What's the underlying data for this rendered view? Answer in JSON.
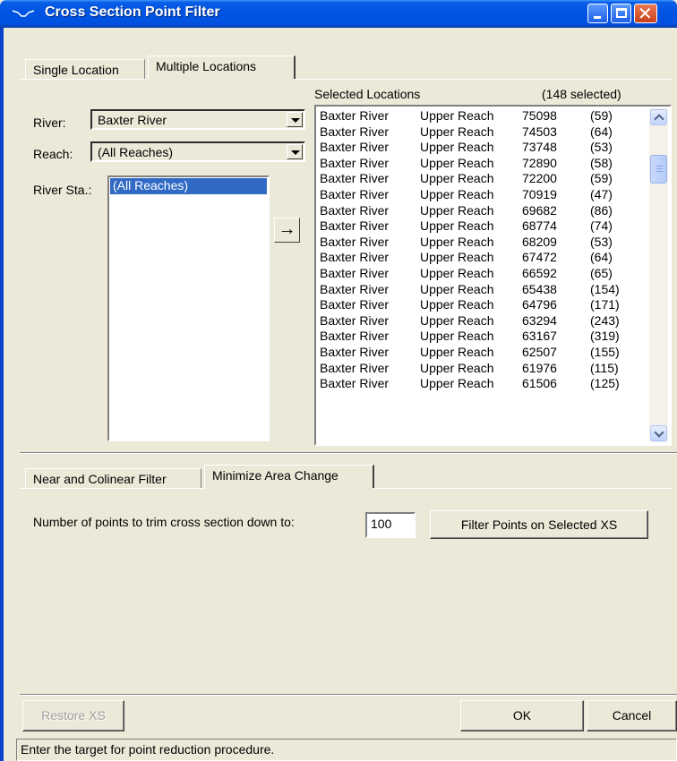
{
  "window": {
    "title": "Cross Section Point Filter"
  },
  "top_tabs": [
    "Single Location",
    "Multiple Locations"
  ],
  "river": {
    "label": "River:",
    "value": "Baxter River"
  },
  "reach": {
    "label": "Reach:",
    "value": "(All Reaches)"
  },
  "river_sta": {
    "label": "River Sta.:",
    "selected_item": "(All Reaches)"
  },
  "add_arrow": "→",
  "selected_locations": {
    "header": "Selected Locations",
    "count_text": "(148 selected)",
    "rows": [
      {
        "river": "Baxter River",
        "reach": "Upper Reach",
        "station": "75098",
        "points": "(59)"
      },
      {
        "river": "Baxter River",
        "reach": "Upper Reach",
        "station": "74503",
        "points": "(64)"
      },
      {
        "river": "Baxter River",
        "reach": "Upper Reach",
        "station": "73748",
        "points": "(53)"
      },
      {
        "river": "Baxter River",
        "reach": "Upper Reach",
        "station": "72890",
        "points": "(58)"
      },
      {
        "river": "Baxter River",
        "reach": "Upper Reach",
        "station": "72200",
        "points": "(59)"
      },
      {
        "river": "Baxter River",
        "reach": "Upper Reach",
        "station": "70919",
        "points": "(47)"
      },
      {
        "river": "Baxter River",
        "reach": "Upper Reach",
        "station": "69682",
        "points": "(86)"
      },
      {
        "river": "Baxter River",
        "reach": "Upper Reach",
        "station": "68774",
        "points": "(74)"
      },
      {
        "river": "Baxter River",
        "reach": "Upper Reach",
        "station": "68209",
        "points": "(53)"
      },
      {
        "river": "Baxter River",
        "reach": "Upper Reach",
        "station": "67472",
        "points": "(64)"
      },
      {
        "river": "Baxter River",
        "reach": "Upper Reach",
        "station": "66592",
        "points": "(65)"
      },
      {
        "river": "Baxter River",
        "reach": "Upper Reach",
        "station": "65438",
        "points": "(154)"
      },
      {
        "river": "Baxter River",
        "reach": "Upper Reach",
        "station": "64796",
        "points": "(171)"
      },
      {
        "river": "Baxter River",
        "reach": "Upper Reach",
        "station": "63294",
        "points": "(243)"
      },
      {
        "river": "Baxter River",
        "reach": "Upper Reach",
        "station": "63167",
        "points": "(319)"
      },
      {
        "river": "Baxter River",
        "reach": "Upper Reach",
        "station": "62507",
        "points": "(155)"
      },
      {
        "river": "Baxter River",
        "reach": "Upper Reach",
        "station": "61976",
        "points": "(115)"
      },
      {
        "river": "Baxter River",
        "reach": "Upper Reach",
        "station": "61506",
        "points": "(125)"
      }
    ]
  },
  "filter_tabs": [
    "Near and Colinear Filter",
    "Minimize Area Change"
  ],
  "trim": {
    "label": "Number of points to trim cross section down to:",
    "value": "100",
    "button": "Filter Points on Selected XS"
  },
  "buttons": {
    "restore": "Restore XS",
    "ok": "OK",
    "cancel": "Cancel"
  },
  "status_text": "Enter the target for point reduction procedure.",
  "colors": {
    "titlebar": "#0054e3",
    "face": "#ece9d8",
    "selection": "#316ac5"
  }
}
